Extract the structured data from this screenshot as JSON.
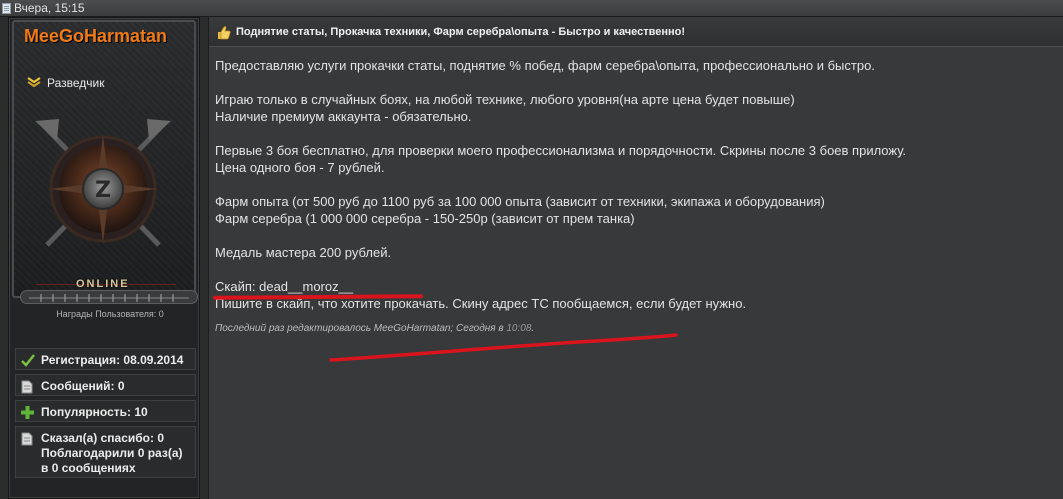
{
  "topbar": {
    "date": "Вчера, 15:15"
  },
  "user": {
    "name": "MeeGoHarmatan",
    "rank": "Разведчик",
    "status": "ONLINE",
    "awards_label": "Награды Пользователя: 0",
    "stats": [
      {
        "icon": "check-icon",
        "label": "Регистрация: 08.09.2014"
      },
      {
        "icon": "document-icon",
        "label": "Сообщений: 0"
      },
      {
        "icon": "plus-icon",
        "label": "Популярность: 10"
      },
      {
        "icon": "document-icon",
        "label": "Сказал(а) спасибо: 0 Поблагодарили 0 раз(а) в 0 сообщениях"
      }
    ]
  },
  "post": {
    "title": "Поднятие статы, Прокачка техники, Фарм серебра\\опыта - Быстро и качественно!",
    "lines": [
      "Предоставляю услуги прокачки статы, поднятие % побед, фарм серебра\\опыта, профессионально и быстро.",
      "Играю только в случайных боях, на любой технике, любого уровня(на арте цена будет повыше)",
      "Наличие премиум аккаунта - обязательно.",
      "Первые 3 боя бесплатно, для проверки моего профессионализма и порядочности. Скрины после 3 боев приложу.",
      "Цена одного боя - 7 рублей.",
      "Фарм опыта (от 500 руб до 1100 руб за 100 000 опыта (зависит от техники, экипажа и оборудования)",
      "Фарм серебра (1 000 000 серебра - 150-250р (зависит от прем танка)",
      "Медаль мастера 200 рублей.",
      "Скайп: dead__moroz__",
      "Пишите в скайп, что хотите прокачать. Скину адрес ТС пообщаемся, если будет нужно."
    ],
    "edited_prefix": "Последний раз редактировалось MeeGoHarmatan; Сегодня в ",
    "edited_time": "10:08",
    "edited_suffix": "."
  },
  "colors": {
    "username": "#f07a18",
    "annotation_red": "#d9141c",
    "background": "#38393a"
  }
}
